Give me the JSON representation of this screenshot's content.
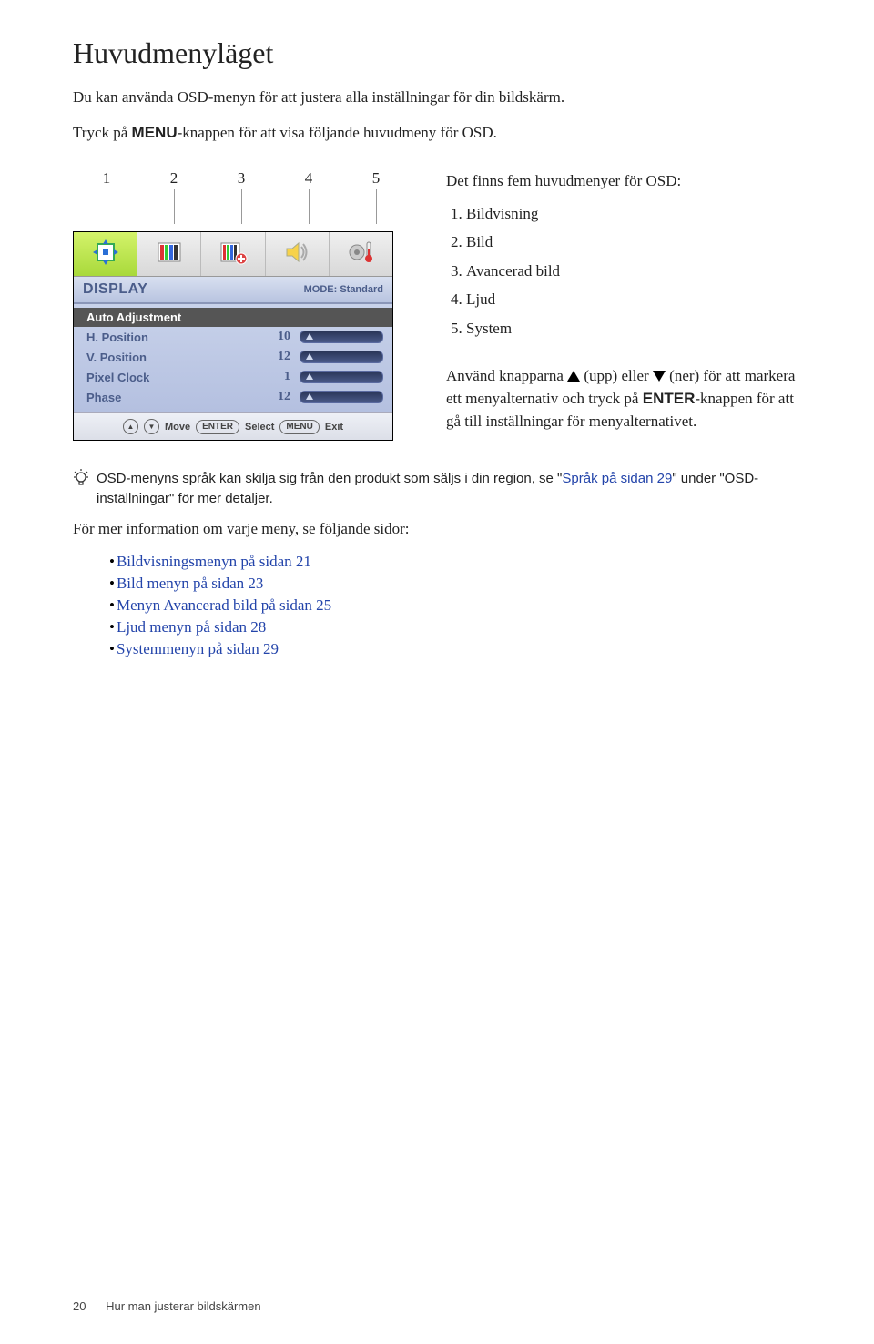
{
  "title": "Huvudmenyläget",
  "intro1_a": "Du kan använda OSD-menyn för att justera alla inställningar för din bildskärm.",
  "intro2_a": "Tryck på ",
  "intro2_menu": "MENU",
  "intro2_b": "-knappen för att visa följande huvudmeny för OSD.",
  "col_numbers": [
    "1",
    "2",
    "3",
    "4",
    "5"
  ],
  "osd": {
    "display_label": "DISPLAY",
    "mode_label": "MODE: Standard",
    "rows": [
      {
        "label": "Auto Adjustment",
        "val": "",
        "slider": false
      },
      {
        "label": "H. Position",
        "val": "10",
        "slider": true
      },
      {
        "label": "V. Position",
        "val": "12",
        "slider": true
      },
      {
        "label": "Pixel Clock",
        "val": "1",
        "slider": true
      },
      {
        "label": "Phase",
        "val": "12",
        "slider": true
      }
    ],
    "footer": {
      "move": "Move",
      "enter": "ENTER",
      "select": "Select",
      "menu": "MENU",
      "exit": "Exit"
    }
  },
  "right": {
    "intro": "Det finns fem huvudmenyer för OSD:",
    "list": [
      "Bildvisning",
      "Bild",
      "Avancerad bild",
      "Ljud",
      "System"
    ],
    "para_a": "Använd knapparna ",
    "para_up": " (upp) eller ",
    "para_ner": " (ner) för att markera ett menyalternativ och tryck på ",
    "para_enter": "ENTER",
    "para_b": "-knappen för att gå till inställningar för menyalternativet."
  },
  "tip": {
    "a": "OSD-menyns språk kan skilja sig från den produkt som säljs i din region, se \"",
    "link": "Språk på sidan 29",
    "b": "\" under \"OSD-inställningar\" för mer detaljer."
  },
  "moreinfo": "För mer information om varje meny, se följande sidor:",
  "bullets": [
    "Bildvisningsmenyn på sidan 21",
    "Bild menyn på sidan 23",
    "Menyn Avancerad bild på sidan 25",
    "Ljud menyn på sidan 28",
    "Systemmenyn på sidan 29"
  ],
  "footer": {
    "page": "20",
    "section": "Hur man justerar bildskärmen"
  }
}
